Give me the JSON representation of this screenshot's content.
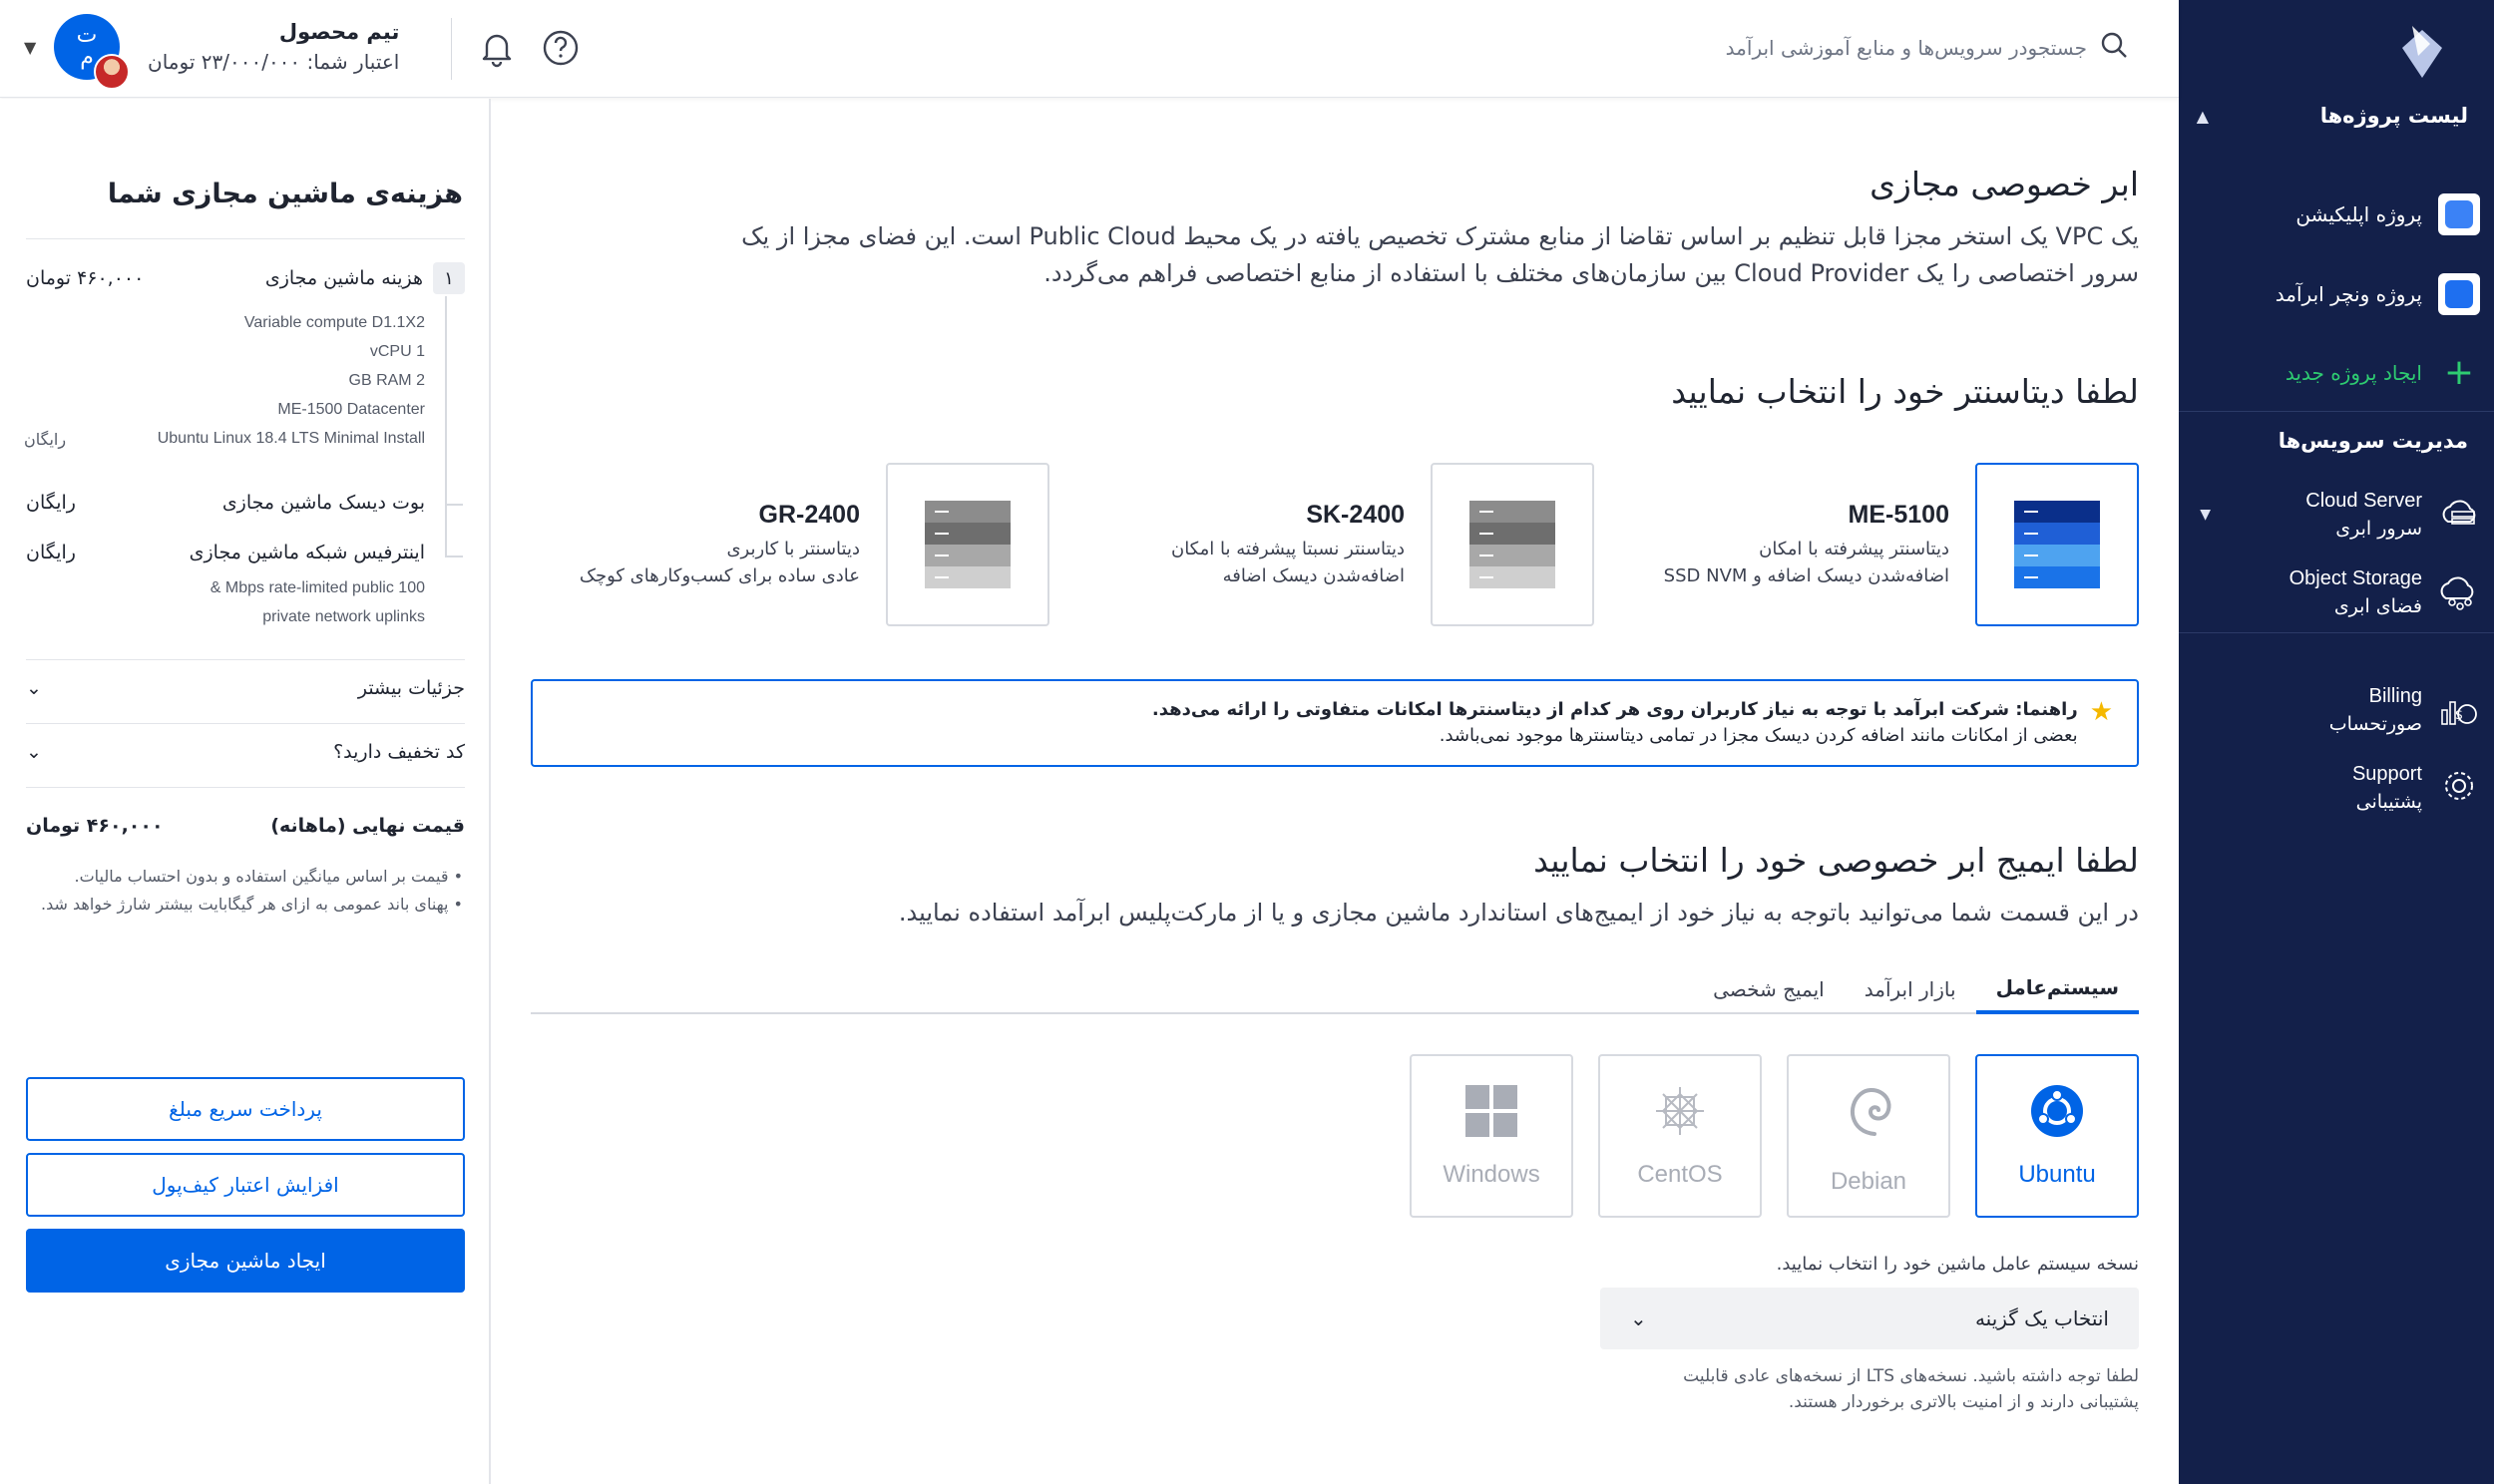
{
  "sidebar": {
    "projects_header": "لیست پروژه‌ها",
    "projects": [
      {
        "label": "پروژه اپلیکیشن",
        "color": "#3b82f6"
      },
      {
        "label": "پروژه ونچر ابرآمد",
        "color": "#1e6ff0"
      }
    ],
    "new_project": "ایجاد پروژه جدید",
    "services_header": "مدیریت سرویس‌ها",
    "services": [
      {
        "en": "Cloud Server",
        "fa": "سرور ابری"
      },
      {
        "en": "Object Storage",
        "fa": "فضای ابری"
      }
    ],
    "billing": {
      "en": "Billing",
      "fa": "صورتحساب"
    },
    "support": {
      "en": "Support",
      "fa": "پشتیبانی"
    }
  },
  "header": {
    "search_placeholder": "جستجودر سرویس‌ها و منابع آموزشی ابرآمد",
    "account_name": "تیم محصول",
    "credit": "اعتبار شما: ۲۳/۰۰۰/۰۰۰ تومان",
    "avatar_top": "ت",
    "avatar_bottom": "م"
  },
  "summary": {
    "title": "هزینه‌ی ماشین مجازی شما",
    "step": "۱",
    "vm_cost_label": "هزینه ماشین مجازی",
    "vm_cost_value": "۴۶۰,۰۰۰ تومان",
    "specs": [
      "Variable compute D1.1X2",
      "1 vCPU",
      "2 GB RAM",
      "ME-1500 Datacenter",
      "Ubuntu Linux 18.4 LTS Minimal Install"
    ],
    "free": "رایگان",
    "boot_disk": "بوت دیسک ماشین مجازی",
    "network": "اینترفیس شبکه ماشین مجازی",
    "network_spec_1": "100 Mbps rate-limited public &",
    "network_spec_2": "private network uplinks",
    "more_details": "جزئیات بیشتر",
    "discount": "کد تخفیف دارید؟",
    "final_label": "قیمت نهایی (ماهانه)",
    "final_value": "۴۶۰,۰۰۰ تومان",
    "note_1": "• قیمت بر اساس میانگین استفاده و بدون احتساب مالیات.",
    "note_2": "• پهنای باند عمومی به ازای هر گیگابایت بیشتر شارژ خواهد شد.",
    "btn_quick_pay": "پرداخت سریع مبلغ",
    "btn_add_credit": "افزایش اعتبار کیف‌پول",
    "btn_create_vm": "ایجاد ماشین مجازی"
  },
  "main": {
    "title": "ابر خصوصی مجازی",
    "desc_1": "یک VPC یک استخر مجزا قابل تنظیم بر اساس تقاضا از منابع مشترک تخصیص یافته در یک محیط Public Cloud است. این فضای مجزا از یک",
    "desc_2": "سرور اختصاصی را یک Cloud Provider بین سازمان‌های مختلف با استفاده از منابع اختصاصی فراهم می‌گردد.",
    "dc_title": "لطفا دیتاسنتر خود را انتخاب نمایید",
    "datacenters": [
      {
        "name": "ME-5100",
        "desc_1": "دیتاسنتر پیشرفته با امکان",
        "desc_2": "اضافه‌شدن دیسک اضافه و SSD NVM"
      },
      {
        "name": "SK-2400",
        "desc_1": "دیتاسنتر نسبتا پیشرفته با امکان",
        "desc_2": "اضافه‌شدن دیسک اضافه"
      },
      {
        "name": "GR-2400",
        "desc_1": "دیتاسنتر با کاربری",
        "desc_2": "عادی ساده برای کسب‌وکارهای کوچک"
      }
    ],
    "hint_bold": "راهنما: شرکت ابرآمد با توجه به نیاز کاربران روی هر کدام از دیتاسنترها امکانات متفاوتی را ارائه می‌دهد.",
    "hint_2": "بعضی از امکانات مانند اضافه کردن دیسک مجزا در تمامی دیتاسنترها موجود نمی‌باشد.",
    "image_title": "لطفا ایمیج ابر خصوصی خود را انتخاب نمایید",
    "image_desc": "در این قسمت شما می‌توانید باتوجه به نیاز خود از ایمیج‌های استاندارد ماشین مجازی و یا از مارکت‌پلیس ابرآمد استفاده نمایید.",
    "tabs": [
      "سیستم‌عامل",
      "بازار ابرآمد",
      "ایمیج شخصی"
    ],
    "os": [
      "Ubuntu",
      "Debian",
      "CentOS",
      "Windows"
    ],
    "version_label": "نسخه سیستم عامل ماشین خود را انتخاب نمایید.",
    "select_placeholder": "انتخاب یک گزینه",
    "lts_note_1": "لطفا توجه داشته باشید. نسخه‌های LTS از نسخه‌های عادی قابلیت",
    "lts_note_2": "پشتیبانی دارند و از امنیت بالاتری برخوردار هستند."
  },
  "colors": {
    "primary": "#0064e6",
    "sidebar": "#13204a",
    "new_project": "#2ecc71"
  }
}
